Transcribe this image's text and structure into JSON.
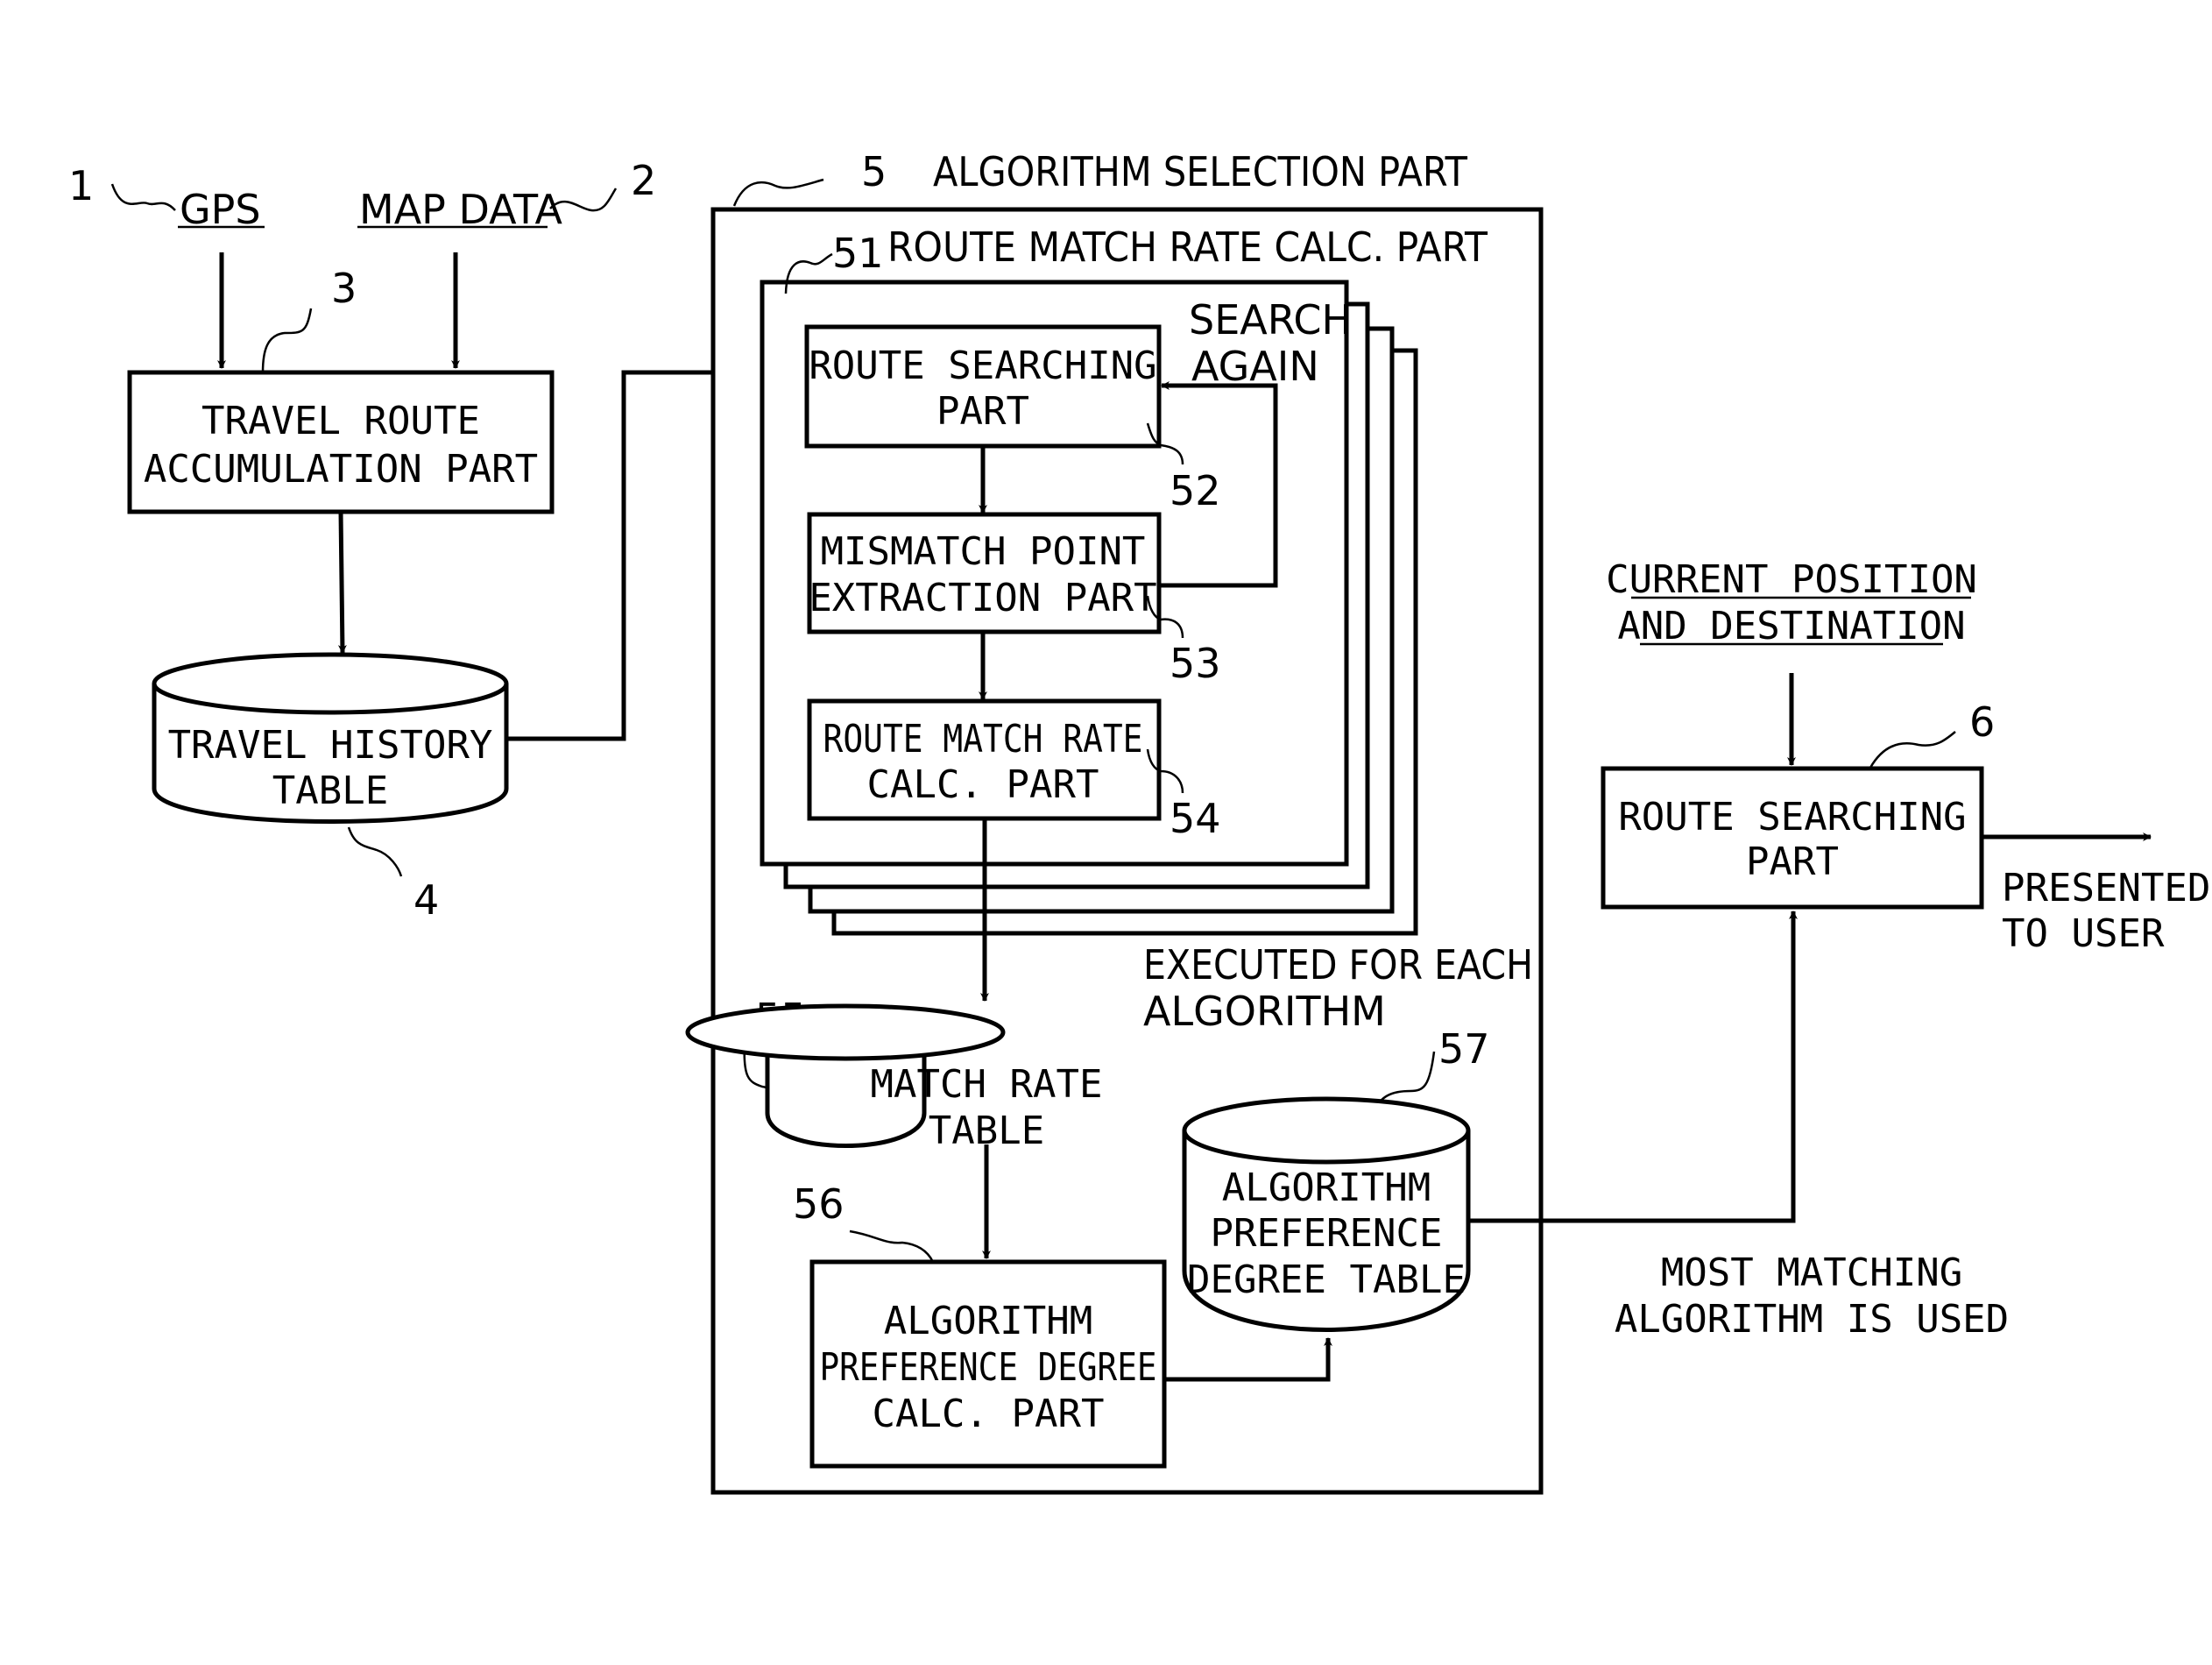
{
  "inputs": {
    "gps": {
      "ref": "1",
      "label": "GPS"
    },
    "map_data": {
      "ref": "2",
      "label": "MAP DATA"
    },
    "current_position": {
      "lines": [
        "CURRENT POSITION",
        "AND DESTINATION"
      ]
    }
  },
  "travel_route_accumulation": {
    "ref": "3",
    "lines": [
      "TRAVEL ROUTE",
      "ACCUMULATION PART"
    ]
  },
  "travel_history_table": {
    "ref": "4",
    "lines": [
      "TRAVEL HISTORY",
      "TABLE"
    ]
  },
  "algorithm_selection": {
    "ref": "5",
    "title": "ALGORITHM SELECTION PART",
    "route_match_rate_calc": {
      "ref": "51",
      "title": "ROUTE MATCH RATE CALC. PART"
    },
    "route_searching": {
      "ref": "52",
      "lines": [
        "ROUTE SEARCHING",
        "PART"
      ]
    },
    "search_again": {
      "lines": [
        "SEARCH",
        "AGAIN"
      ]
    },
    "mismatch_point": {
      "ref": "53",
      "lines": [
        "MISMATCH POINT",
        "EXTRACTION PART"
      ]
    },
    "route_match_rate": {
      "ref": "54",
      "lines": [
        "ROUTE MATCH RATE",
        "CALC. PART"
      ]
    },
    "executed_note": {
      "lines": [
        "EXECUTED FOR EACH",
        "ALGORITHM"
      ]
    },
    "match_rate_table": {
      "ref": "55",
      "lines": [
        "MATCH RATE",
        "TABLE"
      ]
    },
    "preference_degree_calc": {
      "ref": "56",
      "lines": [
        "ALGORITHM",
        "PREFERENCE DEGREE",
        "CALC. PART"
      ]
    },
    "preference_degree_table": {
      "ref": "57",
      "lines": [
        "ALGORITHM",
        "PREFERENCE",
        "DEGREE TABLE"
      ]
    }
  },
  "route_searching_final": {
    "ref": "6",
    "lines": [
      "ROUTE SEARCHING",
      "PART"
    ]
  },
  "output_note": {
    "lines": [
      "PRESENTED",
      "TO USER"
    ]
  },
  "most_matching_note": {
    "lines": [
      "MOST MATCHING",
      "ALGORITHM IS USED"
    ]
  }
}
